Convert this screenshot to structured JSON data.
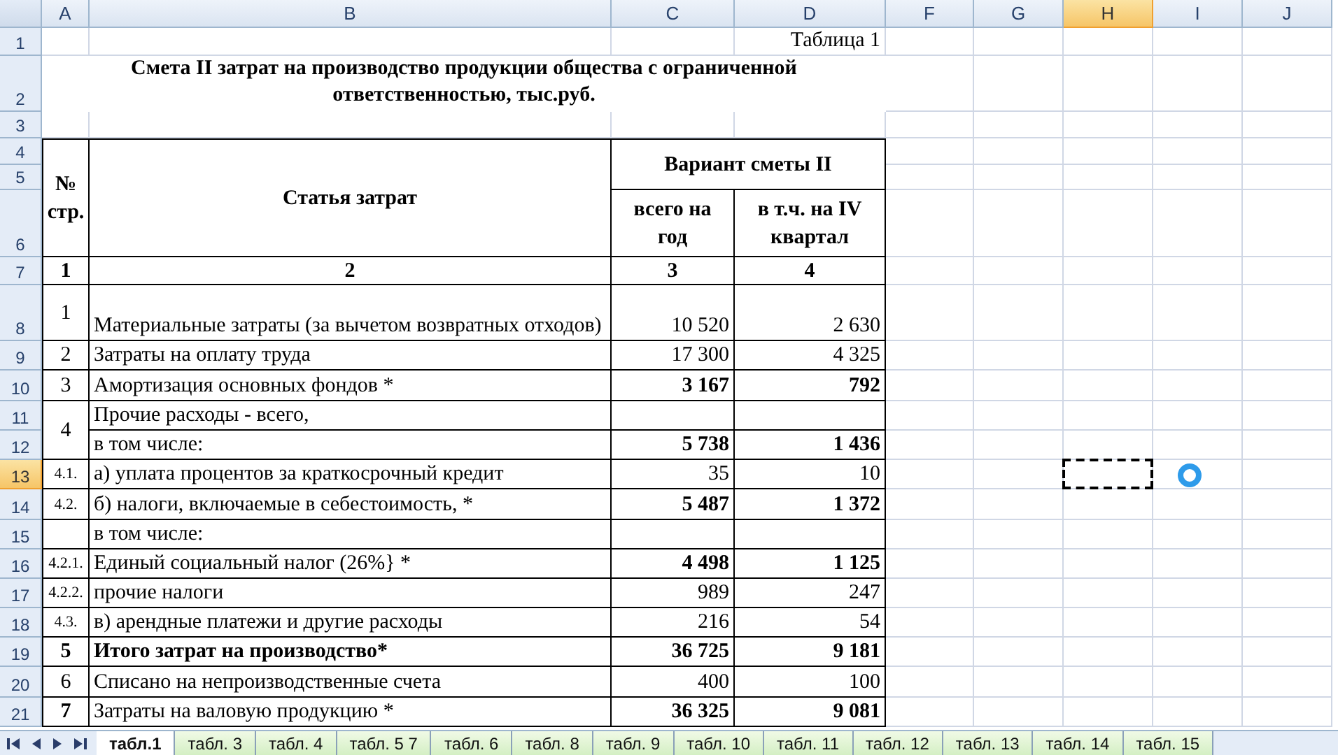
{
  "column_headers": [
    {
      "label": "A",
      "selected": false
    },
    {
      "label": "B",
      "selected": false
    },
    {
      "label": "C",
      "selected": false
    },
    {
      "label": "D",
      "selected": false
    },
    {
      "label": "F",
      "selected": false
    },
    {
      "label": "G",
      "selected": false
    },
    {
      "label": "H",
      "selected": true
    },
    {
      "label": "I",
      "selected": false
    },
    {
      "label": "J",
      "selected": false
    }
  ],
  "row_headers": [
    {
      "label": "1",
      "selected": false
    },
    {
      "label": "2",
      "selected": false
    },
    {
      "label": "3",
      "selected": false
    },
    {
      "label": "4",
      "selected": false
    },
    {
      "label": "5",
      "selected": false
    },
    {
      "label": "6",
      "selected": false
    },
    {
      "label": "7",
      "selected": false
    },
    {
      "label": "8",
      "selected": false
    },
    {
      "label": "9",
      "selected": false
    },
    {
      "label": "10",
      "selected": false
    },
    {
      "label": "11",
      "selected": false
    },
    {
      "label": "12",
      "selected": false
    },
    {
      "label": "13",
      "selected": true
    },
    {
      "label": "14",
      "selected": false
    },
    {
      "label": "15",
      "selected": false
    },
    {
      "label": "16",
      "selected": false
    },
    {
      "label": "17",
      "selected": false
    },
    {
      "label": "18",
      "selected": false
    },
    {
      "label": "19",
      "selected": false
    },
    {
      "label": "20",
      "selected": false
    },
    {
      "label": "21",
      "selected": false
    }
  ],
  "table_label": "Таблица 1",
  "title": "Смета II затрат на производство продукции общества с ограниченной ответственностью, тыс.руб.",
  "header": {
    "number": "№ стр.",
    "item": "Статья затрат",
    "group": "Вариант сметы II",
    "total": "всего на год",
    "q4": "в т.ч. на IV квартал"
  },
  "column_numbers": [
    "1",
    "2",
    "3",
    "4"
  ],
  "rows": [
    {
      "kind": "main",
      "number": "1",
      "bold_number": false,
      "lines": [
        {
          "item": "Материальные затраты (за вычетом возвратных отходов)",
          "total": "10 520",
          "q4": "2 630",
          "bold_item": false,
          "bold_values": false
        }
      ]
    },
    {
      "kind": "main",
      "number": "2",
      "bold_number": false,
      "lines": [
        {
          "item": "Затраты на оплату труда",
          "total": "17 300",
          "q4": "4 325",
          "bold_item": false,
          "bold_values": false
        }
      ]
    },
    {
      "kind": "main",
      "number": "3",
      "bold_number": false,
      "lines": [
        {
          "item": "Амортизация основных фондов *",
          "total": "3 167",
          "q4": "792",
          "bold_item": false,
          "bold_values": true
        }
      ]
    },
    {
      "kind": "main",
      "number": "4",
      "bold_number": false,
      "lines": [
        {
          "item": "Прочие расходы - всего,",
          "bold_item": false
        },
        {
          "item": "в том числе:",
          "total": "5 738",
          "q4": "1 436",
          "bold_item": false,
          "bold_values": true
        }
      ]
    },
    {
      "kind": "sub",
      "number": "4.1.",
      "bold_number": false,
      "lines": [
        {
          "item": "а) уплата процентов за краткосрочный кредит",
          "total": "35",
          "q4": "10",
          "bold_item": false,
          "bold_values": false
        }
      ]
    },
    {
      "kind": "sub",
      "number": "4.2.",
      "bold_number": false,
      "lines": [
        {
          "item": "б) налоги, включаемые в себестоимость, *",
          "total": "5 487",
          "q4": "1 372",
          "bold_item": false,
          "bold_values": true
        }
      ]
    },
    {
      "kind": "sub",
      "lines": [
        {
          "item": "в том числе:",
          "bold_item": false
        }
      ]
    },
    {
      "kind": "sub",
      "number": "4.2.1.",
      "bold_number": false,
      "lines": [
        {
          "item": "Единый социальный налог (26%} *",
          "total": "4 498",
          "q4": "1 125",
          "bold_item": false,
          "bold_values": true
        }
      ]
    },
    {
      "kind": "sub",
      "number": "4.2.2.",
      "bold_number": false,
      "lines": [
        {
          "item": "прочие налоги",
          "total": "989",
          "q4": "247",
          "bold_item": false,
          "bold_values": false
        }
      ]
    },
    {
      "kind": "sub",
      "number": "4.3.",
      "bold_number": false,
      "lines": [
        {
          "item": "в) арендные платежи и другие расходы",
          "total": "216",
          "q4": "54",
          "bold_item": false,
          "bold_values": false
        }
      ]
    },
    {
      "kind": "main",
      "number": "5",
      "bold_number": true,
      "lines": [
        {
          "item": "Итого затрат на производство*",
          "total": "36 725",
          "q4": "9 181",
          "bold_item": true,
          "bold_values": true
        }
      ]
    },
    {
      "kind": "main",
      "number": "6",
      "bold_number": false,
      "lines": [
        {
          "item": "Списано на непроизводственные счета",
          "total": "400",
          "q4": "100",
          "bold_item": false,
          "bold_values": false
        }
      ]
    },
    {
      "kind": "main",
      "number": "7",
      "bold_number": true,
      "lines": [
        {
          "item": "Затраты на валовую продукцию *",
          "total": "36 325",
          "q4": "9 081",
          "bold_item": false,
          "bold_values": true
        }
      ]
    }
  ],
  "tabs": [
    {
      "label": "табл.1",
      "selected": true
    },
    {
      "label": "табл. 3",
      "selected": false
    },
    {
      "label": "табл. 4",
      "selected": false
    },
    {
      "label": "табл. 5 7",
      "selected": false
    },
    {
      "label": "табл. 6",
      "selected": false
    },
    {
      "label": "табл. 8",
      "selected": false
    },
    {
      "label": "табл. 9",
      "selected": false
    },
    {
      "label": "табл. 10",
      "selected": false
    },
    {
      "label": "табл. 11",
      "selected": false
    },
    {
      "label": "табл. 12",
      "selected": false
    },
    {
      "label": "табл. 13",
      "selected": false
    },
    {
      "label": "табл. 14",
      "selected": false
    },
    {
      "label": "табл. 15",
      "selected": false
    }
  ]
}
